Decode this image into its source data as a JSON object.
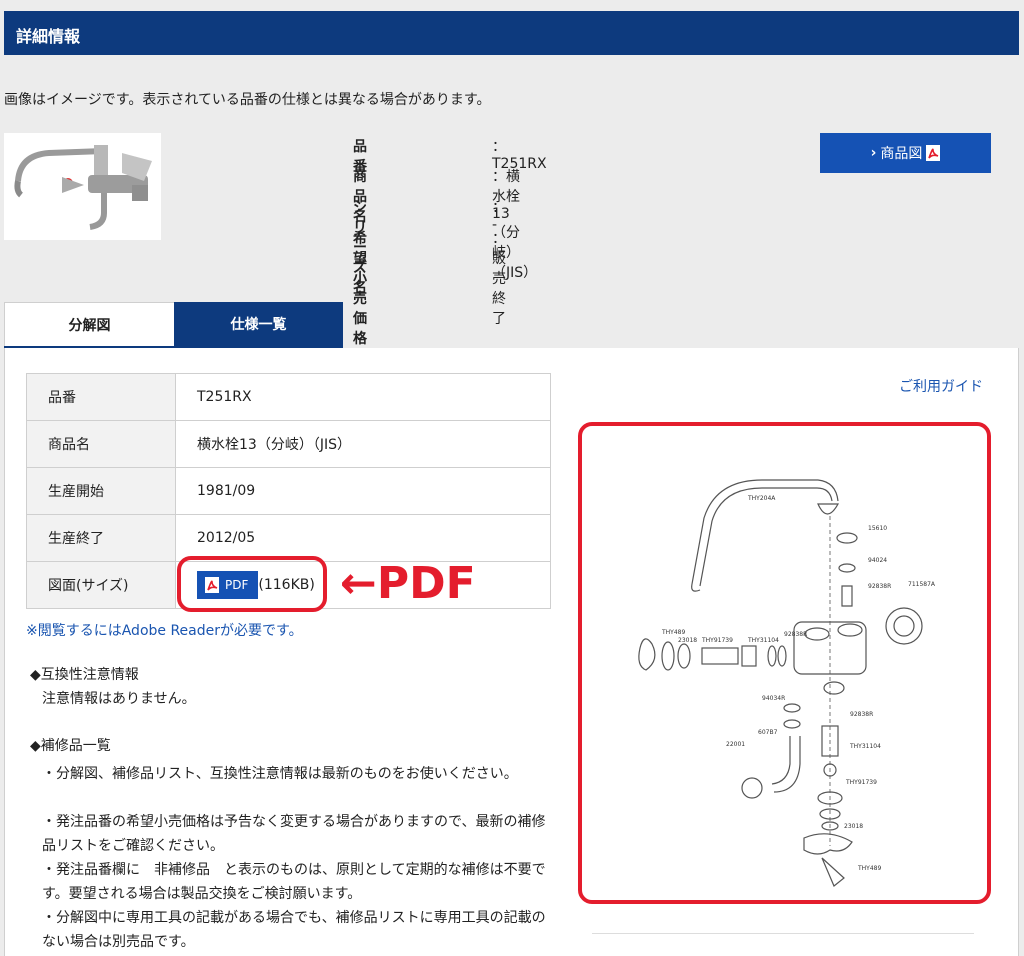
{
  "header": {
    "title": "詳細情報"
  },
  "notice": "画像はイメージです。表示されている品番の仕様とは異なる場合があります。",
  "specs": [
    {
      "label": "品番",
      "value": "：T251RX"
    },
    {
      "label": "商品名",
      "value": "：横水栓13（分岐）（JIS）"
    },
    {
      "label": "シリーズ名",
      "value": "：  -"
    },
    {
      "label": "希望小売価格",
      "value": "：販売終了"
    }
  ],
  "diagram_button": {
    "chevron": "›",
    "label": "商品図",
    "icon": "pdf-icon"
  },
  "tabs": [
    {
      "label": "分解図",
      "active": true
    },
    {
      "label": "仕様一覧",
      "active": false
    }
  ],
  "guide_link": "ご利用ガイド",
  "table": [
    {
      "label": "品番",
      "value": "T251RX"
    },
    {
      "label": "商品名",
      "value": "横水栓13（分岐）（JIS）"
    },
    {
      "label": "生産開始",
      "value": "1981/09"
    },
    {
      "label": "生産終了",
      "value": "2012/05"
    },
    {
      "label": "図面(サイズ)",
      "pdf_label": "PDF",
      "pdf_size": "(116KB)"
    }
  ],
  "annotation": "←PDF",
  "reader_note": "※閲覧するにはAdobe Readerが必要です。",
  "compat": {
    "heading": "◆互換性注意情報",
    "text": "注意情報はありません。"
  },
  "parts": {
    "heading": "◆補修品一覧",
    "lines": [
      "・分解図、補修品リスト、互換性注意情報は最新のものをお使いください。",
      "・発注品番の希望小売価格は予告なく変更する場合がありますので、最新の補修品リストをご確認ください。",
      "・発注品番欄に　非補修品　と表示のものは、原則として定期的な補修は不要です。要望される場合は製品交換をご検討願います。",
      "・分解図中に専用工具の記載がある場合でも、補修品リストに専用工具の記載のない場合は別売品です。"
    ]
  },
  "diagram_labels": [
    "THY204A",
    "15610",
    "94024",
    "92838R",
    "711587A",
    "THY489",
    "23018",
    "THY91739",
    "THY31104",
    "92838R",
    "94034R",
    "92838R",
    "607B7",
    "22001",
    "THY31104",
    "THY91739",
    "23018",
    "THY489"
  ]
}
